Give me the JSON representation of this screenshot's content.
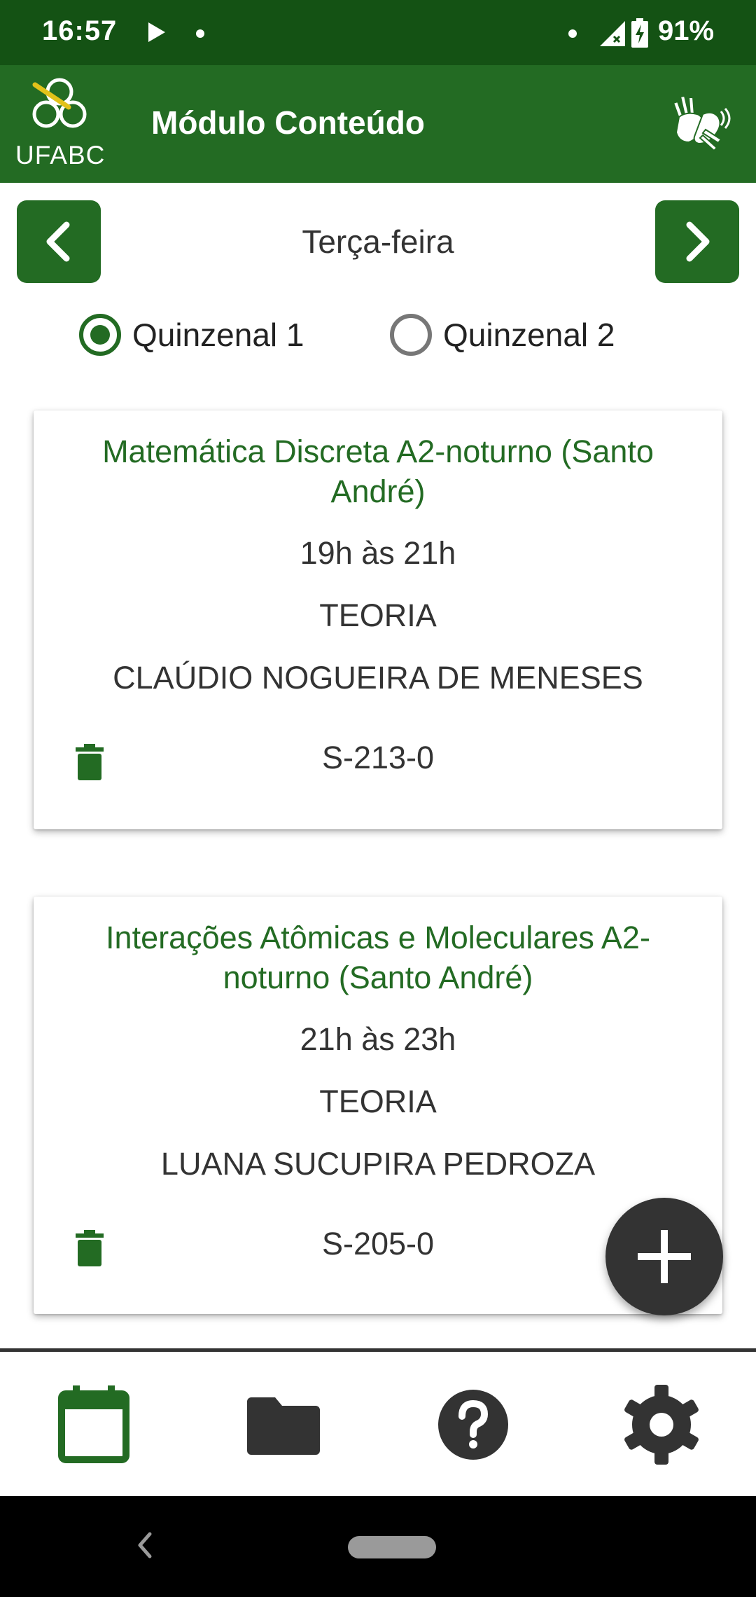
{
  "status_bar": {
    "time": "16:57",
    "battery_percent": "91%",
    "icons": [
      "play-icon",
      "notification-dot-icon",
      "signal-icon",
      "battery-charging-icon"
    ]
  },
  "app_bar": {
    "logo_text": "UFABC",
    "title": "Módulo Conteúdo",
    "libras_icon": "sign-language-hands-icon"
  },
  "day_nav": {
    "day": "Terça-feira",
    "prev_icon": "chevron-left-icon",
    "next_icon": "chevron-right-icon"
  },
  "radios": [
    {
      "label": "Quinzenal 1",
      "checked": true
    },
    {
      "label": "Quinzenal 2",
      "checked": false
    }
  ],
  "classes": [
    {
      "title": "Matemática Discreta A2-noturno (Santo André)",
      "time": "19h às 21h",
      "type": "TEORIA",
      "professor": "CLAÚDIO NOGUEIRA DE MENESES",
      "room": "S-213-0"
    },
    {
      "title": "Interações Atômicas e Moleculares A2-noturno (Santo André)",
      "time": "21h às 23h",
      "type": "TEORIA",
      "professor": "LUANA SUCUPIRA PEDROZA",
      "room": "S-205-0"
    }
  ],
  "fab": {
    "icon": "plus-icon"
  },
  "bottom_nav": [
    {
      "icon": "calendar-icon",
      "active": true
    },
    {
      "icon": "folder-icon",
      "active": false
    },
    {
      "icon": "help-icon",
      "active": false
    },
    {
      "icon": "settings-gear-icon",
      "active": false
    }
  ],
  "colors": {
    "status_bar": "#145214",
    "primary": "#236b23",
    "text": "#333333",
    "fab": "#333333",
    "inactive_icon": "#333333"
  }
}
